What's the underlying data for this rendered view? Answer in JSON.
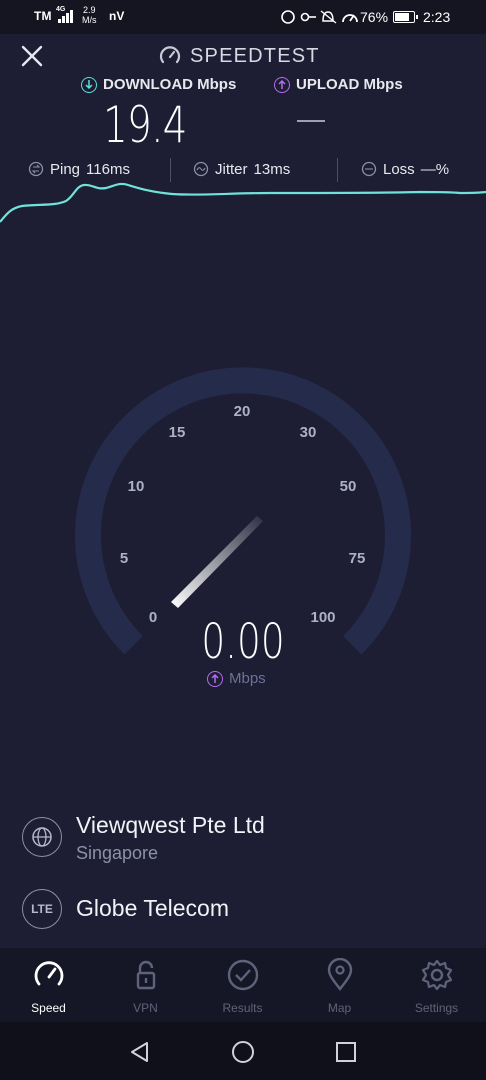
{
  "status_bar": {
    "carrier": "TM",
    "net_type": "4G",
    "net_speed_top": "2.9",
    "net_speed_bottom": "M/s",
    "extra": "nV",
    "battery": "76%",
    "time": "2:23"
  },
  "header": {
    "title": "SPEEDTEST",
    "download_label": "DOWNLOAD Mbps",
    "upload_label": "UPLOAD Mbps",
    "download_value": "19.4",
    "upload_value": ""
  },
  "stats": {
    "ping_label": "Ping",
    "ping_value": "116ms",
    "jitter_label": "Jitter",
    "jitter_value": "13ms",
    "loss_label": "Loss",
    "loss_value": "—%"
  },
  "gauge": {
    "ticks": [
      "0",
      "5",
      "10",
      "15",
      "20",
      "30",
      "50",
      "75",
      "100"
    ],
    "value": "0.00",
    "unit": "Mbps"
  },
  "server": {
    "name": "Viewqwest Pte Ltd",
    "location": "Singapore"
  },
  "provider": {
    "badge": "LTE",
    "name": "Globe Telecom"
  },
  "nav": {
    "speed": "Speed",
    "vpn": "VPN",
    "results": "Results",
    "map": "Map",
    "settings": "Settings"
  },
  "colors": {
    "background": "#1d1e33",
    "download_accent": "#5ee0d8",
    "upload_accent": "#b56cf0",
    "graph_line": "#6fe3da"
  }
}
